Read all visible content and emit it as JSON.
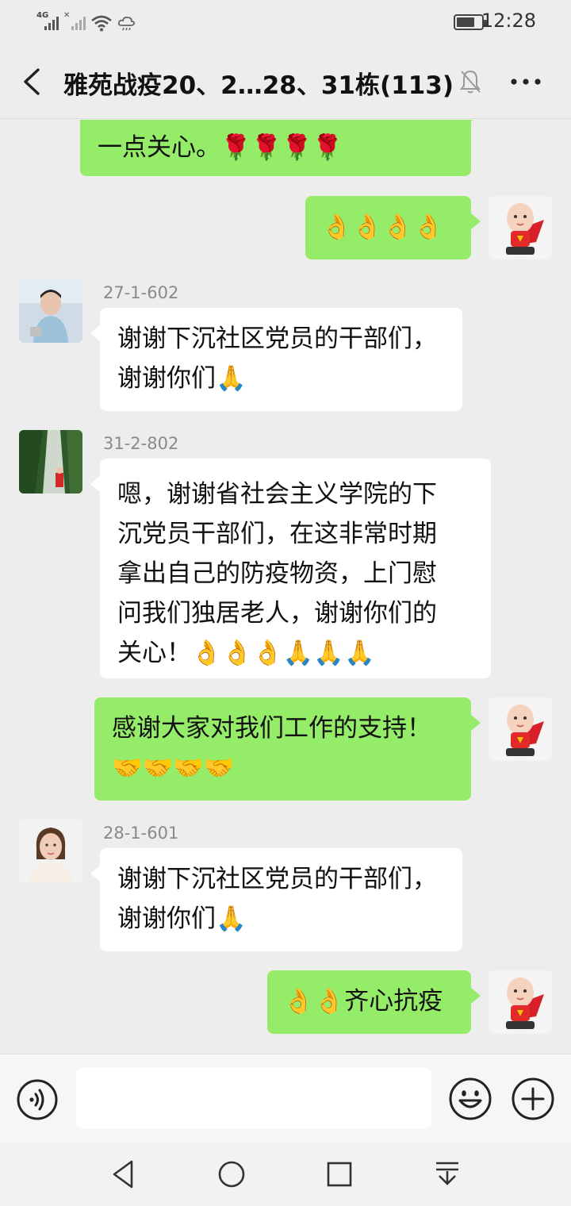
{
  "status_bar": {
    "network_tag": "4G",
    "time": "12:28",
    "icons": [
      "signal-icon",
      "signal-no-sim-icon",
      "wifi-icon",
      "weather-icon",
      "battery-icon"
    ]
  },
  "header": {
    "title": "雅苑战疫20、2…28、31栋(113)",
    "icons": [
      "back-arrow-icon",
      "mute-bell-icon",
      "more-dots-icon"
    ]
  },
  "messages": [
    {
      "side": "right",
      "kind": "partial",
      "lines": [
        "一点关心。🌹🌹🌹🌹"
      ]
    },
    {
      "side": "right",
      "lines": [
        "👌👌👌👌"
      ],
      "avatar": "superhero-baby-avatar"
    },
    {
      "side": "left",
      "sender": "27-1-602",
      "lines": [
        "谢谢下沉社区党员的干部们，",
        "谢谢你们🙏"
      ],
      "avatar": "girl-photo-avatar"
    },
    {
      "side": "left",
      "sender": "31-2-802",
      "lines": [
        "嗯，谢谢省社会主义学院的下",
        "沉党员干部们，在这非常时期",
        "拿出自己的防疫物资，上门慰",
        "问我们独居老人，谢谢你们的",
        "关心！👌👌👌🙏🙏🙏"
      ],
      "avatar": "waterfall-photo-avatar"
    },
    {
      "side": "right",
      "lines": [
        "感谢大家对我们工作的支持！",
        "🤝🤝🤝🤝"
      ],
      "avatar": "superhero-baby-avatar"
    },
    {
      "side": "left",
      "sender": "28-1-601",
      "lines": [
        "谢谢下沉社区党员的干部们，",
        "谢谢你们🙏"
      ],
      "avatar": "woman-portrait-avatar"
    },
    {
      "side": "right",
      "lines": [
        "👌👌齐心抗疫"
      ],
      "avatar": "superhero-baby-avatar"
    }
  ],
  "input_bar": {
    "message_value": "",
    "icons": [
      "voice-icon",
      "emoji-icon",
      "plus-icon"
    ]
  },
  "nav_bar": {
    "icons": [
      "nav-back-icon",
      "nav-home-icon",
      "nav-recents-icon",
      "nav-notification-icon"
    ]
  },
  "colors": {
    "background": "#ededed",
    "my_bubble": "#95ec69",
    "other_bubble": "#ffffff",
    "nickname": "#8a8a8a"
  }
}
